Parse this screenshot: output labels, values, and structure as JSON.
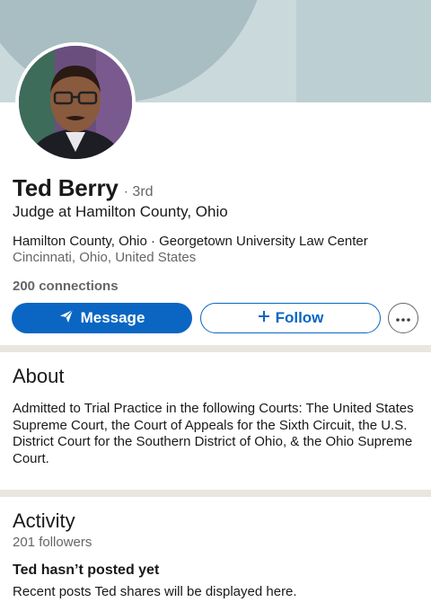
{
  "profile": {
    "name": "Ted Berry",
    "degree": "· 3rd",
    "headline": "Judge at Hamilton County, Ohio",
    "company_line": "Hamilton County, Ohio · Georgetown University Law Center",
    "location": "Cincinnati, Ohio, United States",
    "connections": "200 connections"
  },
  "actions": {
    "message_label": "Message",
    "follow_label": "Follow",
    "message_icon": "send-icon",
    "follow_icon": "plus-icon",
    "more_icon": "more-dots-icon"
  },
  "about": {
    "title": "About",
    "text": "Admitted to Trial Practice in the following Courts: The United States Supreme Court, the Court of Appeals for the Sixth Circuit, the U.S. District Court for the Southern District of Ohio, & the Ohio Supreme Court."
  },
  "activity": {
    "title": "Activity",
    "followers": "201 followers",
    "empty_title": "Ted hasn’t posted yet",
    "empty_text": "Recent posts Ted shares will be displayed here."
  },
  "colors": {
    "accent": "#0a66c2",
    "banner": "#c9d9dc",
    "divider": "#e9e5df"
  }
}
